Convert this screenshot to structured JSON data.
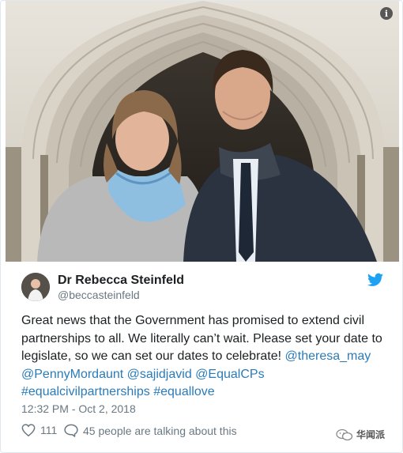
{
  "photo": {
    "alt": "",
    "info_icon": "info-icon"
  },
  "author": {
    "name": "Dr Rebecca Steinfeld",
    "handle": "@beccasteinfeld",
    "avatar_icon": "avatar",
    "brand_icon": "twitter-bird-icon",
    "brand_color": "#1da1f2"
  },
  "tweet": {
    "text_prefix": "Great news that the Government has promised to extend civil partnerships to all. We literally can’t wait. Please set your date to legislate, so we can set our dates to celebrate! ",
    "mentions": [
      "@theresa_may",
      "@PennyMordaunt",
      "@sajidjavid",
      "@EqualCPs"
    ],
    "hashtags": [
      "#equalcivilpartnerships",
      "#equallove"
    ],
    "link_color": "#2b7bb9"
  },
  "timestamp": "12:32 PM - Oct 2, 2018",
  "actions": {
    "like_count": "111",
    "reply_label": "45 people are talking about this"
  },
  "watermark": {
    "text": "华闻派"
  }
}
